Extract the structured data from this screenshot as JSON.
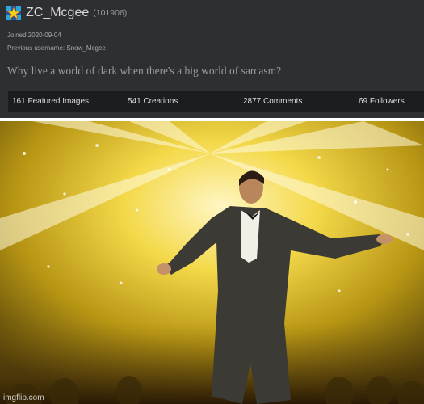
{
  "profile": {
    "username": "ZC_Mcgee",
    "user_id": "(101906)",
    "joined": "Joined 2020-09-04",
    "previous_username": "Previous username: Snow_Mcgee",
    "bio": "Why live a world of dark when there's a big world of sarcasm?",
    "avatar_icon": "checkered-star-icon"
  },
  "stats": {
    "featured_images": "161 Featured Images",
    "creations": "541 Creations",
    "comments": "2877 Comments",
    "followers": "69 Followers"
  },
  "meme": {
    "watermark": "imgflip.com"
  },
  "colors": {
    "panel": "#2e2f33",
    "stats_bar": "#1c1d1f",
    "username": "#d8d8d8",
    "bio": "#9d9d9d",
    "stage_glow": "#f4d94a"
  }
}
